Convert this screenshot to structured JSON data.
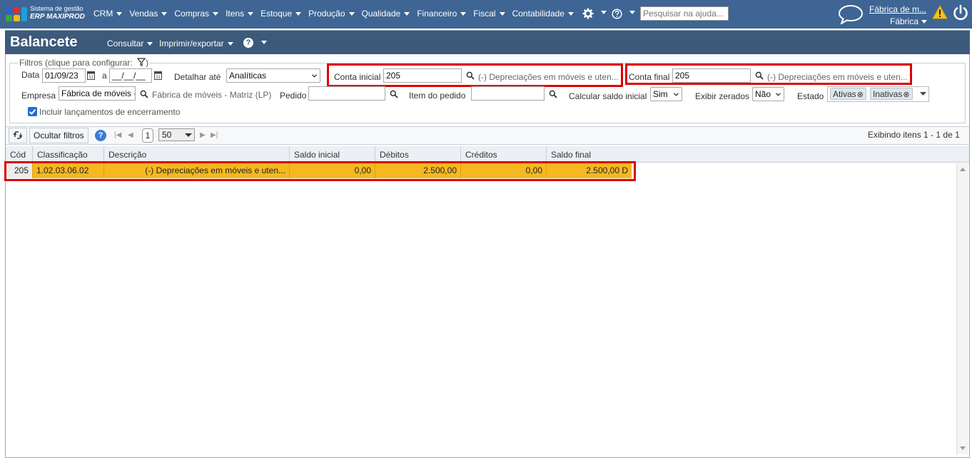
{
  "topnav": {
    "logo_line1": "Sistema de gestão",
    "logo_line2": "ERP MAXIPROD",
    "menu": [
      "CRM",
      "Vendas",
      "Compras",
      "Itens",
      "Estoque",
      "Produção",
      "Qualidade",
      "Financeiro",
      "Fiscal",
      "Contabilidade"
    ],
    "help_search_placeholder": "Pesquisar na ajuda...",
    "company_link": "Fábrica de m...",
    "company_sub": "Fábrica",
    "bg_color": "#3e6594"
  },
  "page": {
    "title": "Balancete",
    "menu_consultar": "Consultar",
    "menu_imprimir": "Imprimir/exportar",
    "header_color": "#3d5a7a"
  },
  "filters": {
    "legend": "Filtros (clique para configurar:",
    "data_label": "Data",
    "data_from": "01/09/23",
    "a_label": "a",
    "data_to": "__/__/__",
    "detalhar_label": "Detalhar até",
    "detalhar_value": "Analíticas",
    "conta_inicial_label": "Conta inicial",
    "conta_inicial_value": "205",
    "conta_inicial_desc": "(-) Depreciações em móveis e uten...",
    "conta_final_label": "Conta final",
    "conta_final_value": "205",
    "conta_final_desc": "(-) Depreciações em móveis e uten...",
    "empresa_label": "Empresa",
    "empresa_value": "Fábrica de móveis -",
    "empresa_desc": "Fábrica de móveis - Matriz (LP)",
    "pedido_label": "Pedido",
    "pedido_value": "",
    "item_pedido_label": "Item do pedido",
    "item_pedido_value": "",
    "saldo_inicial_label": "Calcular saldo inicial",
    "saldo_inicial_value": "Sim",
    "exibir_zerados_label": "Exibir zerados",
    "exibir_zerados_value": "Não",
    "estado_label": "Estado",
    "estado_tags": [
      "Ativas",
      "Inativas"
    ],
    "incluir_label": "Incluir lançamentos de encerramento",
    "incluir_checked": true
  },
  "toolbar": {
    "ocultar_filtros": "Ocultar filtros",
    "page": "1",
    "page_size": "50",
    "items_info": "Exibindo itens 1 - 1 de 1"
  },
  "grid": {
    "columns": [
      "Cód",
      "Classificação",
      "Descrição",
      "Saldo inicial",
      "Débitos",
      "Créditos",
      "Saldo final"
    ],
    "rows": [
      {
        "cod": "205",
        "classificacao": "1.02.03.06.02",
        "descricao": "(-) Depreciações em móveis e uten...",
        "saldo_inicial": "0,00",
        "debitos": "2.500,00",
        "creditos": "0,00",
        "saldo_final": "2.500,00 D"
      }
    ],
    "row_highlight_color": "#f5b820"
  },
  "highlight_color": "#dd0000"
}
